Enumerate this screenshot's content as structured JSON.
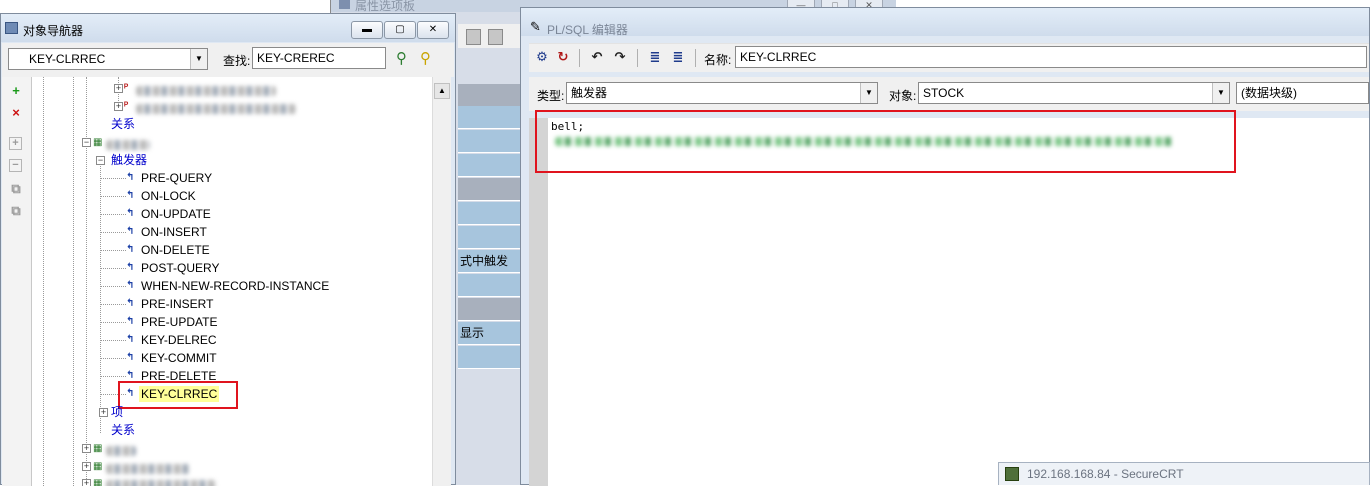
{
  "property_palette": {
    "title": "属性选项板",
    "rows": [
      {
        "text": ""
      },
      {
        "text": ""
      },
      {
        "text": ""
      },
      {
        "text": ""
      },
      {
        "text": ""
      },
      {
        "text": ""
      },
      {
        "text": ""
      },
      {
        "text": "式中触发"
      },
      {
        "text": ""
      },
      {
        "text": ""
      },
      {
        "text": "显示"
      },
      {
        "text": ""
      }
    ]
  },
  "navigator": {
    "title": "对象导航器",
    "current_node": "KEY-CLRREC",
    "find_label": "查找:",
    "find_value": "KEY-CREREC",
    "tree": {
      "relations_label": "关系",
      "triggers_label": "触发器",
      "triggers": [
        "PRE-QUERY",
        "ON-LOCK",
        "ON-UPDATE",
        "ON-INSERT",
        "ON-DELETE",
        "POST-QUERY",
        "WHEN-NEW-RECORD-INSTANCE",
        "PRE-INSERT",
        "PRE-UPDATE",
        "KEY-DELREC",
        "KEY-COMMIT",
        "PRE-DELETE",
        "KEY-CLRREC"
      ],
      "items_label": "项",
      "relations_label_2": "关系"
    },
    "side_tools": {
      "create": "+",
      "delete": "×",
      "expand": "+",
      "collapse": "−"
    }
  },
  "editor": {
    "title": "PL/SQL 编辑器",
    "name_label": "名称:",
    "name_value": "KEY-CLRREC",
    "type_label": "类型:",
    "type_value": "触发器",
    "object_label": "对象:",
    "object_value": "STOCK",
    "level_value": "(数据块级)",
    "code_line1": "bell;"
  },
  "taskbar": {
    "securecrt": "192.168.168.84 - SecureCRT"
  },
  "colors": {
    "highlight_box": "#e0141e",
    "selected_node_bg": "#ffff99",
    "tree_label_blue": "#0000cc"
  }
}
